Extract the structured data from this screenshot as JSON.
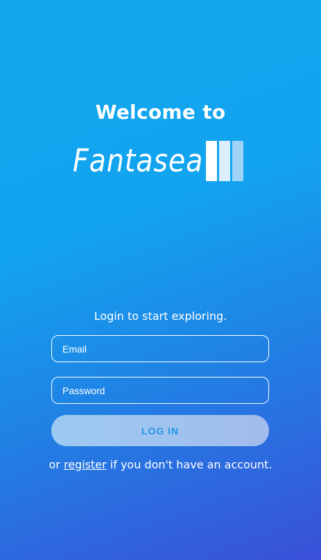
{
  "welcome": {
    "heading": "Welcome to"
  },
  "logo": {
    "text": "Fantasea",
    "bars_colors": [
      "#ffffff",
      "#dcefff",
      "#9fd4f8"
    ]
  },
  "login": {
    "tagline": "Login to start exploring.",
    "email_placeholder": "Email",
    "password_placeholder": "Password",
    "button_label": "LOG IN"
  },
  "register": {
    "prefix": "or",
    "link_label": "register",
    "suffix": "if you don't have an account."
  },
  "colors": {
    "gradient_start": "#14a6ee",
    "gradient_end": "#3a50d8",
    "button_text": "#2596e8"
  }
}
